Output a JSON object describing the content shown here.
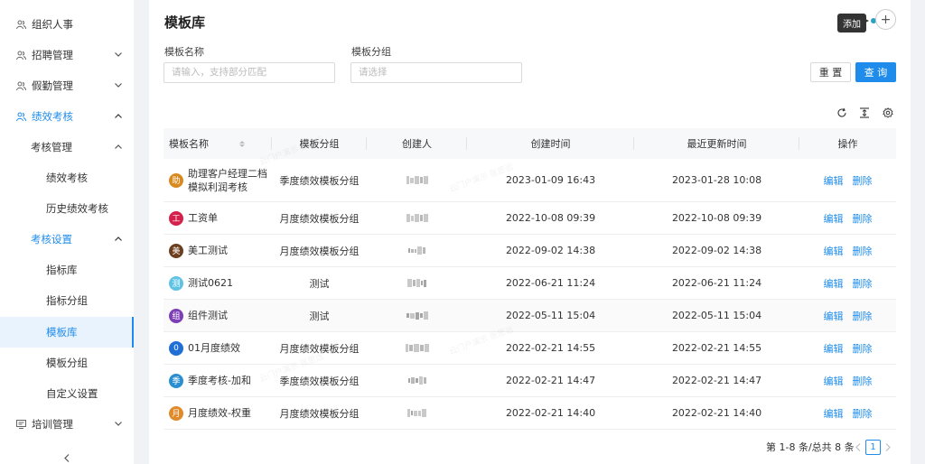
{
  "sidebar": {
    "items": [
      {
        "label": "组织人事",
        "icon": "people-icon",
        "chevron": false
      },
      {
        "label": "招聘管理",
        "icon": "people-icon",
        "chevron": "down"
      },
      {
        "label": "假勤管理",
        "icon": "people-icon",
        "chevron": "down"
      },
      {
        "label": "绩效考核",
        "icon": "people-icon",
        "chevron": "up",
        "active": true
      },
      {
        "label": "考核管理",
        "chevron": "up"
      },
      {
        "label": "绩效考核"
      },
      {
        "label": "历史绩效考核"
      },
      {
        "label": "考核设置",
        "chevron": "up",
        "active": true
      },
      {
        "label": "指标库"
      },
      {
        "label": "指标分组"
      },
      {
        "label": "模板库",
        "selected": true
      },
      {
        "label": "模板分组"
      },
      {
        "label": "自定义设置"
      },
      {
        "label": "培训管理",
        "icon": "training-icon",
        "chevron": "down"
      }
    ]
  },
  "header": {
    "title": "模板库",
    "add_tooltip": "添加",
    "add_symbol": "+"
  },
  "filters": {
    "name_label": "模板名称",
    "name_placeholder": "请输入，支持部分匹配",
    "group_label": "模板分组",
    "group_placeholder": "请选择",
    "reset_label": "重 置",
    "query_label": "查 询"
  },
  "table": {
    "columns": [
      "模板名称",
      "模板分组",
      "创建人",
      "创建时间",
      "最近更新时间",
      "操作"
    ],
    "edit_label": "编辑",
    "delete_label": "删除",
    "rows": [
      {
        "avatar": "助",
        "color": "#d98a1f",
        "name": "助理客户经理二档模拟利润考核",
        "group": "季度绩效模板分组",
        "created": "2023-01-09 16:43",
        "updated": "2023-01-28 10:08"
      },
      {
        "avatar": "工",
        "color": "#d4204a",
        "name": "工资单",
        "group": "月度绩效模板分组",
        "created": "2022-10-08 09:39",
        "updated": "2022-10-08 09:39"
      },
      {
        "avatar": "美",
        "color": "#6b3e1e",
        "name": "美工测试",
        "group": "月度绩效模板分组",
        "created": "2022-09-02 14:38",
        "updated": "2022-09-02 14:38"
      },
      {
        "avatar": "测",
        "color": "#5fc3e4",
        "name": "测试0621",
        "group": "测试",
        "created": "2022-06-21 11:24",
        "updated": "2022-06-21 11:24"
      },
      {
        "avatar": "组",
        "color": "#7c3fb5",
        "name": "组件测试",
        "group": "测试",
        "created": "2022-05-11 15:04",
        "updated": "2022-05-11 15:04"
      },
      {
        "avatar": "0",
        "color": "#1f6fd6",
        "name": "01月度绩效",
        "group": "月度绩效模板分组",
        "created": "2022-02-21 14:55",
        "updated": "2022-02-21 14:55"
      },
      {
        "avatar": "季",
        "color": "#2a8fd0",
        "name": "季度考核-加和",
        "group": "季度绩效模板分组",
        "created": "2022-02-21 14:47",
        "updated": "2022-02-21 14:47"
      },
      {
        "avatar": "月",
        "color": "#e08a2a",
        "name": "月度绩效-权重",
        "group": "月度绩效模板分组",
        "created": "2022-02-21 14:40",
        "updated": "2022-02-21 14:40"
      }
    ]
  },
  "pagination": {
    "summary": "第 1-8 条/总共 8 条",
    "current_page": "1"
  }
}
